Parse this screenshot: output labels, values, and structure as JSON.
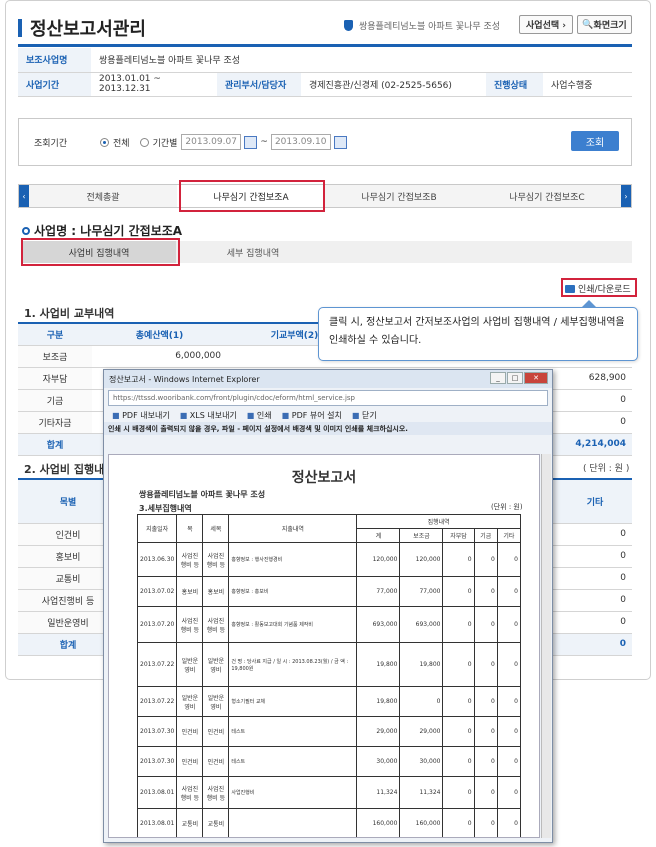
{
  "header": {
    "title": "정산보고서관리",
    "biz_name": "쌍용플레티넘노블 아파트 꽃나무 조성",
    "select_label": "사업선택 ›",
    "screen_label": "화면크기"
  },
  "info": {
    "row1": {
      "k1": "보조사업명",
      "v1": "쌍용플레티넘노블 아파트 꽃나무 조성"
    },
    "row2": {
      "k1": "사업기간",
      "v1": "2013.01.01 ~ 2013.12.31",
      "k2": "관리부서/담당자",
      "v2": "경제진흥관/신경제 (02-2525-5656)",
      "k3": "진행상태",
      "v3": "사업수행중"
    }
  },
  "search": {
    "label": "조회기간",
    "opt_all": "전체",
    "opt_period": "기간별",
    "from": "2013.09.07",
    "to": "2013.09.10",
    "tilde": "~",
    "query": "조회"
  },
  "tabs": [
    "전체총괄",
    "나무심기 간접보조A",
    "나무심기 간접보조B",
    "나무심기 간접보조C"
  ],
  "tab_arrows": {
    "left": "‹",
    "right": "›"
  },
  "project": {
    "title": "사업명 : 나무심기 간접보조A"
  },
  "subtabs": [
    "사업비 집행내역",
    "세부 집행내역"
  ],
  "print_label": "인쇄/다운로드",
  "section1": {
    "title": "1. 사업비 교부내역",
    "headers": [
      "구분",
      "총예산액(1)",
      "기교부액(2)",
      ""
    ],
    "rows": [
      {
        "label": "보조금",
        "total": "6,000,000",
        "right": ""
      },
      {
        "label": "자부담",
        "total": "",
        "right": "628,900"
      },
      {
        "label": "기금",
        "total": "",
        "right": "0"
      },
      {
        "label": "기타자금",
        "total": "",
        "right": "0"
      },
      {
        "label": "합계",
        "total": "",
        "right": "4,214,004"
      }
    ]
  },
  "section2": {
    "title": "2. 사업비 집행내",
    "unit": "( 단위 : 원 )",
    "headers": [
      "목별",
      "기타"
    ],
    "rows": [
      {
        "label": "인건비",
        "right": "0"
      },
      {
        "label": "홍보비",
        "right": "0"
      },
      {
        "label": "교통비",
        "right": "0"
      },
      {
        "label": "사업진행비 등",
        "right": "0"
      },
      {
        "label": "일반운영비",
        "right": "0"
      },
      {
        "label": "합계",
        "right": "0"
      }
    ]
  },
  "tooltip": "클릭 시, 정산보고서 간저보조사업의 사업비 집행내역 / 세부집행내역을 인쇄하실 수 있습니다.",
  "popup": {
    "window_title": "정산보고서 - Windows Internet Explorer",
    "url": "https://ttssd.wooribank.com/front/plugin/cdoc/eform/html_service.jsp",
    "toolbar": [
      "PDF 내보내기",
      "XLS 내보내기",
      "인쇄",
      "PDF 뷰어 설치",
      "닫기"
    ],
    "notice": "인쇄 시 배경색이 출력되지 않을 경우, 파일 - 페이지 설정에서 배경색 및 이미지 인쇄를 체크하십시오.",
    "report": {
      "title": "정산보고서",
      "biz": "쌍용플레티넘노블 아파트 꽃나무 조성",
      "section": "3.세부집행내역",
      "unit": "(단위 : 원)",
      "headers": [
        "지출일자",
        "목",
        "세목",
        "지출내역",
        "집행내역",
        "계",
        "보조금",
        "자부담",
        "기금",
        "기타"
      ],
      "rows": [
        {
          "date": "2013.06.30",
          "mok": "사업진행비 등",
          "semok": "사업진행비 등",
          "desc": "홍향정보 : 행사진행경비",
          "sum": "120,000",
          "sub": "120,000",
          "self": "0",
          "fund": "0",
          "etc": "0"
        },
        {
          "date": "2013.07.02",
          "mok": "홍보비",
          "semok": "홍보비",
          "desc": "홍향정보 : 홍보비",
          "sum": "77,000",
          "sub": "77,000",
          "self": "0",
          "fund": "0",
          "etc": "0"
        },
        {
          "date": "2013.07.20",
          "mok": "사업진행비 등",
          "semok": "사업진행비 등",
          "desc": "홍향정보 : 활동보고대회 기념품 제작비",
          "sum": "693,000",
          "sub": "693,000",
          "self": "0",
          "fund": "0",
          "etc": "0"
        },
        {
          "date": "2013.07.22",
          "mok": "일반운영비",
          "semok": "일반운영비",
          "desc": "건 명 : 당사료 지급 / 일 시 : 2013.08.23(월) / 금 액 : 19,800원",
          "sum": "19,800",
          "sub": "19,800",
          "self": "0",
          "fund": "0",
          "etc": "0"
        },
        {
          "date": "2013.07.22",
          "mok": "일반운영비",
          "semok": "일반운영비",
          "desc": "형소기필터 교체",
          "sum": "19,800",
          "sub": "0",
          "self": "0",
          "fund": "0",
          "etc": "0"
        },
        {
          "date": "2013.07.30",
          "mok": "인건비",
          "semok": "인건비",
          "desc": "테스트",
          "sum": "29,000",
          "sub": "29,000",
          "self": "0",
          "fund": "0",
          "etc": "0"
        },
        {
          "date": "2013.07.30",
          "mok": "인건비",
          "semok": "인건비",
          "desc": "테스트",
          "sum": "30,000",
          "sub": "30,000",
          "self": "0",
          "fund": "0",
          "etc": "0"
        },
        {
          "date": "2013.08.01",
          "mok": "사업진행비 등",
          "semok": "사업진행비 등",
          "desc": "사업진행비",
          "sum": "11,324",
          "sub": "11,324",
          "self": "0",
          "fund": "0",
          "etc": "0"
        },
        {
          "date": "2013.08.01",
          "mok": "교통비",
          "semok": "교통비",
          "desc": "",
          "sum": "160,000",
          "sub": "160,000",
          "self": "0",
          "fund": "0",
          "etc": "0"
        }
      ]
    }
  }
}
